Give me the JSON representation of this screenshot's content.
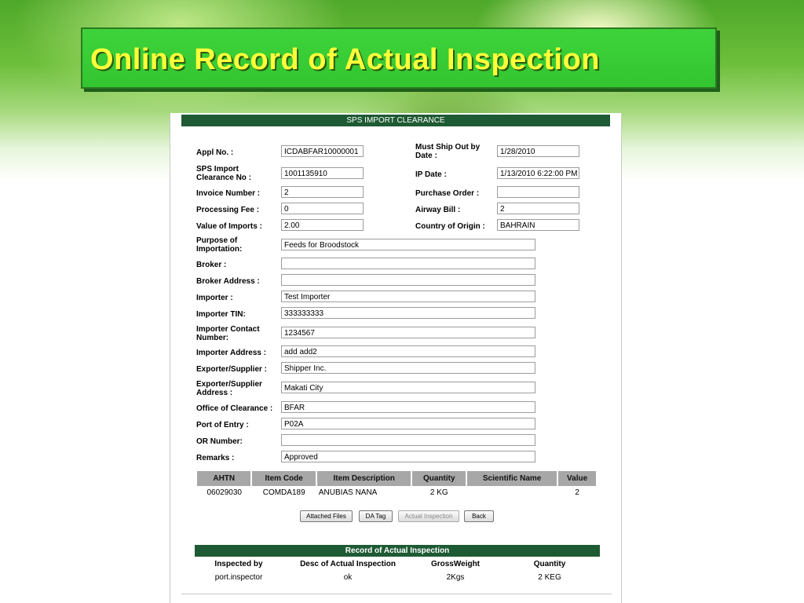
{
  "slide": {
    "title": "Online Record of Actual Inspection",
    "colors": {
      "title_bar": "#3ed33b",
      "title_text": "#ffff3a",
      "panel_header": "#1e5a33",
      "table_header": "#a7a7a7"
    }
  },
  "form": {
    "header": "SPS IMPORT CLEARANCE",
    "appl_no": {
      "label": "Appl No. :",
      "value": "ICDABFAR10000001"
    },
    "must_ship": {
      "label": "Must Ship Out by Date :",
      "value": "1/28/2010"
    },
    "sps_no": {
      "label": "SPS Import Clearance No :",
      "value": "1001135910"
    },
    "ip_date": {
      "label": "IP Date :",
      "value": "1/13/2010 6:22:00 PM"
    },
    "invoice": {
      "label": "Invoice Number :",
      "value": "2"
    },
    "purchase_order": {
      "label": "Purchase Order :",
      "value": ""
    },
    "processing_fee": {
      "label": "Processing Fee :",
      "value": "0"
    },
    "airway_bill": {
      "label": "Airway Bill :",
      "value": "2"
    },
    "value_imports": {
      "label": "Value of Imports :",
      "value": "2.00"
    },
    "country_origin": {
      "label": "Country of Origin :",
      "value": "BAHRAIN"
    },
    "purpose": {
      "label": "Purpose of Importation:",
      "value": "Feeds for Broodstock"
    },
    "broker": {
      "label": "Broker :",
      "value": ""
    },
    "broker_address": {
      "label": "Broker Address :",
      "value": ""
    },
    "importer": {
      "label": "Importer :",
      "value": "Test Importer"
    },
    "importer_tin": {
      "label": "Importer TIN:",
      "value": "333333333"
    },
    "importer_contact": {
      "label": "Importer Contact Number:",
      "value": "1234567"
    },
    "importer_address": {
      "label": "Importer Address :",
      "value": "add add2"
    },
    "exporter": {
      "label": "Exporter/Supplier :",
      "value": "Shipper Inc."
    },
    "exporter_address": {
      "label": "Exporter/Supplier Address :",
      "value": "Makati City"
    },
    "office_clearance": {
      "label": "Office of Clearance :",
      "value": "BFAR"
    },
    "port_entry": {
      "label": "Port of Entry :",
      "value": "P02A"
    },
    "or_number": {
      "label": "OR Number:",
      "value": ""
    },
    "remarks": {
      "label": "Remarks :",
      "value": "Approved"
    }
  },
  "items": {
    "headers": [
      "AHTN",
      "Item Code",
      "Item Description",
      "Quantity",
      "Scientific Name",
      "Value"
    ],
    "rows": [
      [
        "06029030",
        "COMDA189",
        "ANUBIAS NANA",
        "2  KG",
        "",
        "2"
      ]
    ]
  },
  "buttons": {
    "attached_files": "Attached Files",
    "da_tag": "DA Tag",
    "actual_inspection": "Actual Inspection",
    "back": "Back"
  },
  "record": {
    "header": "Record of Actual Inspection",
    "columns": [
      "Inspected by",
      "Desc of Actual Inspection",
      "GrossWeight",
      "Quantity"
    ],
    "values": [
      "port.inspector",
      "ok",
      "2Kgs",
      "2 KEG"
    ]
  }
}
